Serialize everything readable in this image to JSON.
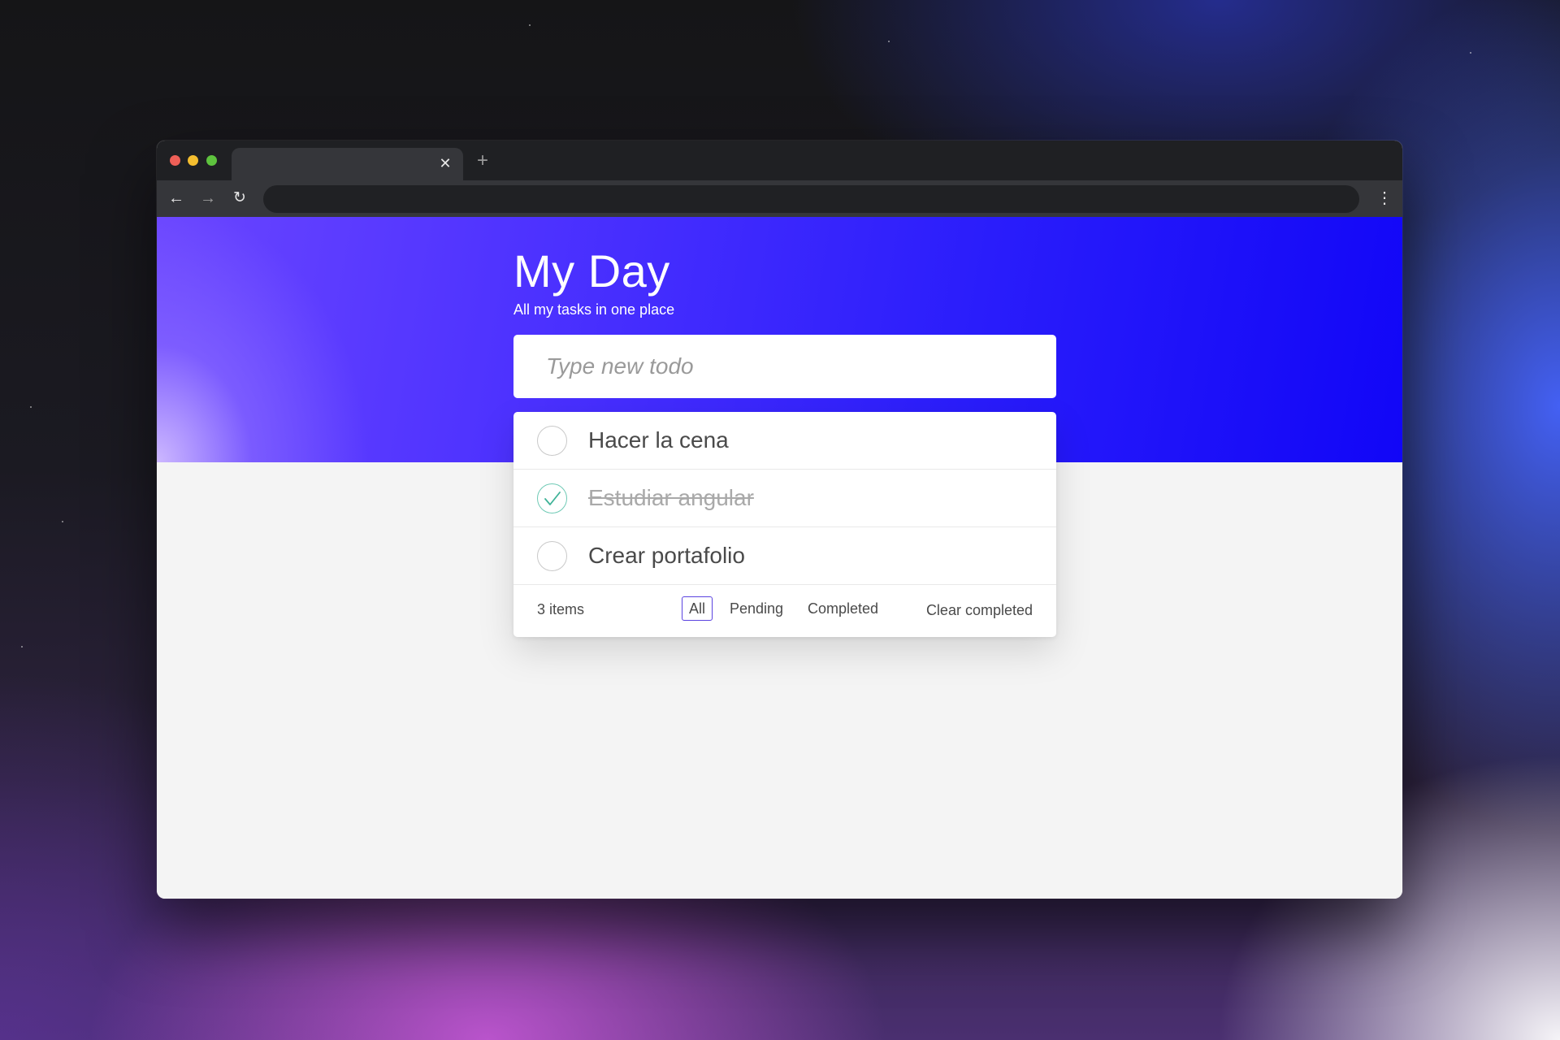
{
  "browser": {
    "tab_title": "",
    "tab_close_icon": "close-icon",
    "new_tab_icon": "plus-icon",
    "address_value": "",
    "nav_back_icon": "arrow-left-icon",
    "nav_forward_icon": "arrow-right-icon",
    "reload_icon": "reload-icon",
    "menu_icon": "kebab-menu-icon"
  },
  "header": {
    "title": "My Day",
    "subtitle": "All my tasks in one place"
  },
  "new_todo": {
    "placeholder": "Type new todo",
    "value": ""
  },
  "todos": [
    {
      "label": "Hacer la cena",
      "completed": false
    },
    {
      "label": "Estudiar angular",
      "completed": true
    },
    {
      "label": "Crear portafolio",
      "completed": false
    }
  ],
  "footer": {
    "count": "3 items",
    "filters": [
      {
        "label": "All",
        "selected": true
      },
      {
        "label": "Pending",
        "selected": false
      },
      {
        "label": "Completed",
        "selected": false
      }
    ],
    "clear_label": "Clear completed"
  },
  "colors": {
    "hero_start": "#6a45ff",
    "hero_end": "#1106f7",
    "check_done": "#6fcab5",
    "filter_selected_border": "#5b43e0",
    "page_background": "#f4f4f4"
  }
}
